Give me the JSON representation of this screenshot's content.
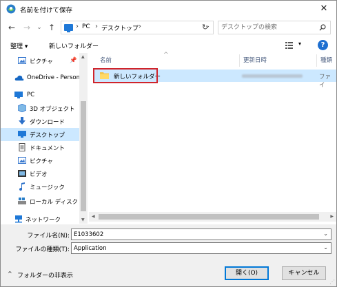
{
  "window": {
    "title": "名前を付けて保存",
    "close": "✕"
  },
  "nav": {
    "back": "←",
    "forward": "→",
    "dropdown": "⌄",
    "up": "↑",
    "breadcrumb": [
      "PC",
      "デスクトップ"
    ],
    "refresh": "↻",
    "search_placeholder": "デスクトップの検索"
  },
  "toolbar": {
    "organize": "整理 ▾",
    "new_folder": "新しいフォルダー",
    "view_dropdown": "▾",
    "help": "?"
  },
  "sidebar": {
    "items": [
      {
        "label": "ピクチャ",
        "icon": "pictures-icon"
      },
      {
        "label": "OneDrive - Person",
        "icon": "onedrive-icon"
      },
      {
        "label": "PC",
        "icon": "pc-icon"
      },
      {
        "label": "3D オブジェクト",
        "icon": "3d-objects-icon"
      },
      {
        "label": "ダウンロード",
        "icon": "download-icon"
      },
      {
        "label": "デスクトップ",
        "icon": "desktop-icon"
      },
      {
        "label": "ドキュメント",
        "icon": "documents-icon"
      },
      {
        "label": "ピクチャ",
        "icon": "pictures-icon"
      },
      {
        "label": "ビデオ",
        "icon": "videos-icon"
      },
      {
        "label": "ミュージック",
        "icon": "music-icon"
      },
      {
        "label": "ローカル ディスク (C",
        "icon": "local-disk-icon"
      },
      {
        "label": "ネットワーク",
        "icon": "network-icon"
      }
    ],
    "selected": "デスクトップ"
  },
  "filelist": {
    "columns": [
      "名前",
      "更新日時",
      "種類"
    ],
    "rows": [
      {
        "name": "新しいフォルダー",
        "type": "ファイ"
      }
    ]
  },
  "form": {
    "filename_label": "ファイル名(N):",
    "filename_value": "E1033602",
    "filetype_label": "ファイルの種類(T):",
    "filetype_value": "Application"
  },
  "footer": {
    "hide_folders": "フォルダーの非表示",
    "open_button": "開く(O)",
    "cancel_button": "キャンセル"
  },
  "colors": {
    "accent": "#0078d7",
    "selection": "#cce8ff",
    "highlight_border": "#d0242b"
  }
}
